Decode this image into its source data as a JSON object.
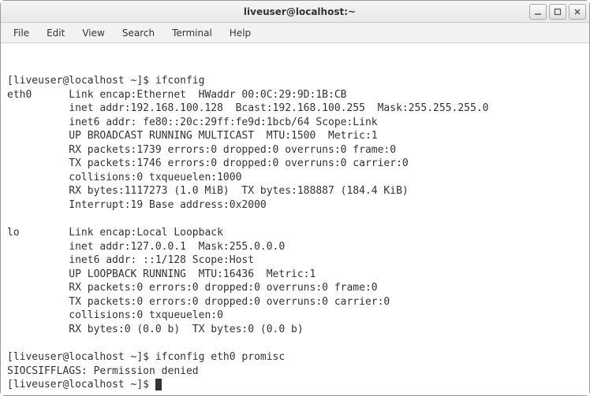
{
  "window": {
    "title": "liveuser@localhost:~"
  },
  "menu": {
    "file": "File",
    "edit": "Edit",
    "view": "View",
    "search": "Search",
    "terminal": "Terminal",
    "help": "Help"
  },
  "terminal": {
    "lines": [
      "[liveuser@localhost ~]$ ifconfig",
      "eth0      Link encap:Ethernet  HWaddr 00:0C:29:9D:1B:CB",
      "          inet addr:192.168.100.128  Bcast:192.168.100.255  Mask:255.255.255.0",
      "          inet6 addr: fe80::20c:29ff:fe9d:1bcb/64 Scope:Link",
      "          UP BROADCAST RUNNING MULTICAST  MTU:1500  Metric:1",
      "          RX packets:1739 errors:0 dropped:0 overruns:0 frame:0",
      "          TX packets:1746 errors:0 dropped:0 overruns:0 carrier:0",
      "          collisions:0 txqueuelen:1000",
      "          RX bytes:1117273 (1.0 MiB)  TX bytes:188887 (184.4 KiB)",
      "          Interrupt:19 Base address:0x2000",
      "",
      "lo        Link encap:Local Loopback",
      "          inet addr:127.0.0.1  Mask:255.0.0.0",
      "          inet6 addr: ::1/128 Scope:Host",
      "          UP LOOPBACK RUNNING  MTU:16436  Metric:1",
      "          RX packets:0 errors:0 dropped:0 overruns:0 frame:0",
      "          TX packets:0 errors:0 dropped:0 overruns:0 carrier:0",
      "          collisions:0 txqueuelen:0",
      "          RX bytes:0 (0.0 b)  TX bytes:0 (0.0 b)",
      "",
      "[liveuser@localhost ~]$ ifconfig eth0 promisc",
      "SIOCSIFFLAGS: Permission denied"
    ],
    "promptLast": "[liveuser@localhost ~]$ "
  }
}
